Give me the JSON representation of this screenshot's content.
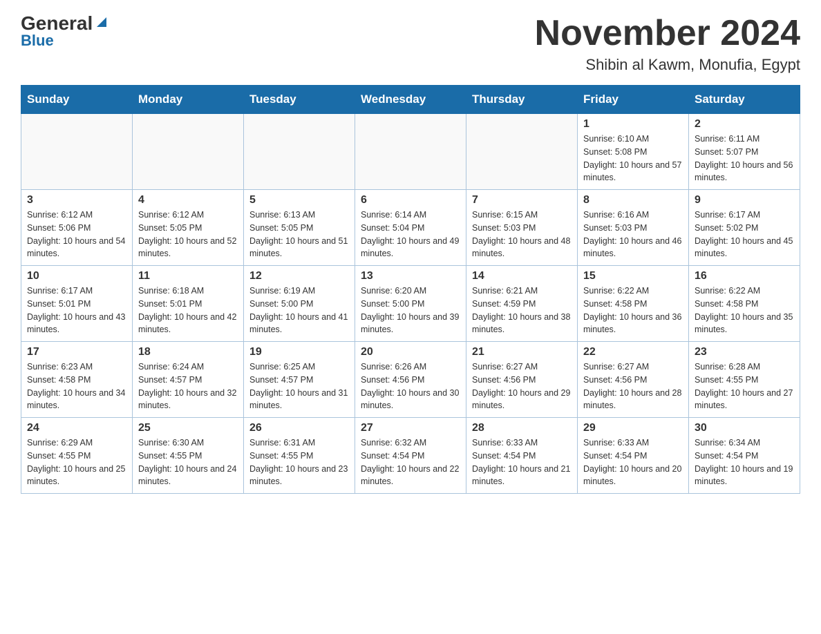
{
  "logo": {
    "general": "General",
    "blue": "Blue"
  },
  "title": "November 2024",
  "subtitle": "Shibin al Kawm, Monufia, Egypt",
  "weekdays": [
    "Sunday",
    "Monday",
    "Tuesday",
    "Wednesday",
    "Thursday",
    "Friday",
    "Saturday"
  ],
  "weeks": [
    [
      {
        "day": "",
        "info": ""
      },
      {
        "day": "",
        "info": ""
      },
      {
        "day": "",
        "info": ""
      },
      {
        "day": "",
        "info": ""
      },
      {
        "day": "",
        "info": ""
      },
      {
        "day": "1",
        "info": "Sunrise: 6:10 AM\nSunset: 5:08 PM\nDaylight: 10 hours and 57 minutes."
      },
      {
        "day": "2",
        "info": "Sunrise: 6:11 AM\nSunset: 5:07 PM\nDaylight: 10 hours and 56 minutes."
      }
    ],
    [
      {
        "day": "3",
        "info": "Sunrise: 6:12 AM\nSunset: 5:06 PM\nDaylight: 10 hours and 54 minutes."
      },
      {
        "day": "4",
        "info": "Sunrise: 6:12 AM\nSunset: 5:05 PM\nDaylight: 10 hours and 52 minutes."
      },
      {
        "day": "5",
        "info": "Sunrise: 6:13 AM\nSunset: 5:05 PM\nDaylight: 10 hours and 51 minutes."
      },
      {
        "day": "6",
        "info": "Sunrise: 6:14 AM\nSunset: 5:04 PM\nDaylight: 10 hours and 49 minutes."
      },
      {
        "day": "7",
        "info": "Sunrise: 6:15 AM\nSunset: 5:03 PM\nDaylight: 10 hours and 48 minutes."
      },
      {
        "day": "8",
        "info": "Sunrise: 6:16 AM\nSunset: 5:03 PM\nDaylight: 10 hours and 46 minutes."
      },
      {
        "day": "9",
        "info": "Sunrise: 6:17 AM\nSunset: 5:02 PM\nDaylight: 10 hours and 45 minutes."
      }
    ],
    [
      {
        "day": "10",
        "info": "Sunrise: 6:17 AM\nSunset: 5:01 PM\nDaylight: 10 hours and 43 minutes."
      },
      {
        "day": "11",
        "info": "Sunrise: 6:18 AM\nSunset: 5:01 PM\nDaylight: 10 hours and 42 minutes."
      },
      {
        "day": "12",
        "info": "Sunrise: 6:19 AM\nSunset: 5:00 PM\nDaylight: 10 hours and 41 minutes."
      },
      {
        "day": "13",
        "info": "Sunrise: 6:20 AM\nSunset: 5:00 PM\nDaylight: 10 hours and 39 minutes."
      },
      {
        "day": "14",
        "info": "Sunrise: 6:21 AM\nSunset: 4:59 PM\nDaylight: 10 hours and 38 minutes."
      },
      {
        "day": "15",
        "info": "Sunrise: 6:22 AM\nSunset: 4:58 PM\nDaylight: 10 hours and 36 minutes."
      },
      {
        "day": "16",
        "info": "Sunrise: 6:22 AM\nSunset: 4:58 PM\nDaylight: 10 hours and 35 minutes."
      }
    ],
    [
      {
        "day": "17",
        "info": "Sunrise: 6:23 AM\nSunset: 4:58 PM\nDaylight: 10 hours and 34 minutes."
      },
      {
        "day": "18",
        "info": "Sunrise: 6:24 AM\nSunset: 4:57 PM\nDaylight: 10 hours and 32 minutes."
      },
      {
        "day": "19",
        "info": "Sunrise: 6:25 AM\nSunset: 4:57 PM\nDaylight: 10 hours and 31 minutes."
      },
      {
        "day": "20",
        "info": "Sunrise: 6:26 AM\nSunset: 4:56 PM\nDaylight: 10 hours and 30 minutes."
      },
      {
        "day": "21",
        "info": "Sunrise: 6:27 AM\nSunset: 4:56 PM\nDaylight: 10 hours and 29 minutes."
      },
      {
        "day": "22",
        "info": "Sunrise: 6:27 AM\nSunset: 4:56 PM\nDaylight: 10 hours and 28 minutes."
      },
      {
        "day": "23",
        "info": "Sunrise: 6:28 AM\nSunset: 4:55 PM\nDaylight: 10 hours and 27 minutes."
      }
    ],
    [
      {
        "day": "24",
        "info": "Sunrise: 6:29 AM\nSunset: 4:55 PM\nDaylight: 10 hours and 25 minutes."
      },
      {
        "day": "25",
        "info": "Sunrise: 6:30 AM\nSunset: 4:55 PM\nDaylight: 10 hours and 24 minutes."
      },
      {
        "day": "26",
        "info": "Sunrise: 6:31 AM\nSunset: 4:55 PM\nDaylight: 10 hours and 23 minutes."
      },
      {
        "day": "27",
        "info": "Sunrise: 6:32 AM\nSunset: 4:54 PM\nDaylight: 10 hours and 22 minutes."
      },
      {
        "day": "28",
        "info": "Sunrise: 6:33 AM\nSunset: 4:54 PM\nDaylight: 10 hours and 21 minutes."
      },
      {
        "day": "29",
        "info": "Sunrise: 6:33 AM\nSunset: 4:54 PM\nDaylight: 10 hours and 20 minutes."
      },
      {
        "day": "30",
        "info": "Sunrise: 6:34 AM\nSunset: 4:54 PM\nDaylight: 10 hours and 19 minutes."
      }
    ]
  ]
}
